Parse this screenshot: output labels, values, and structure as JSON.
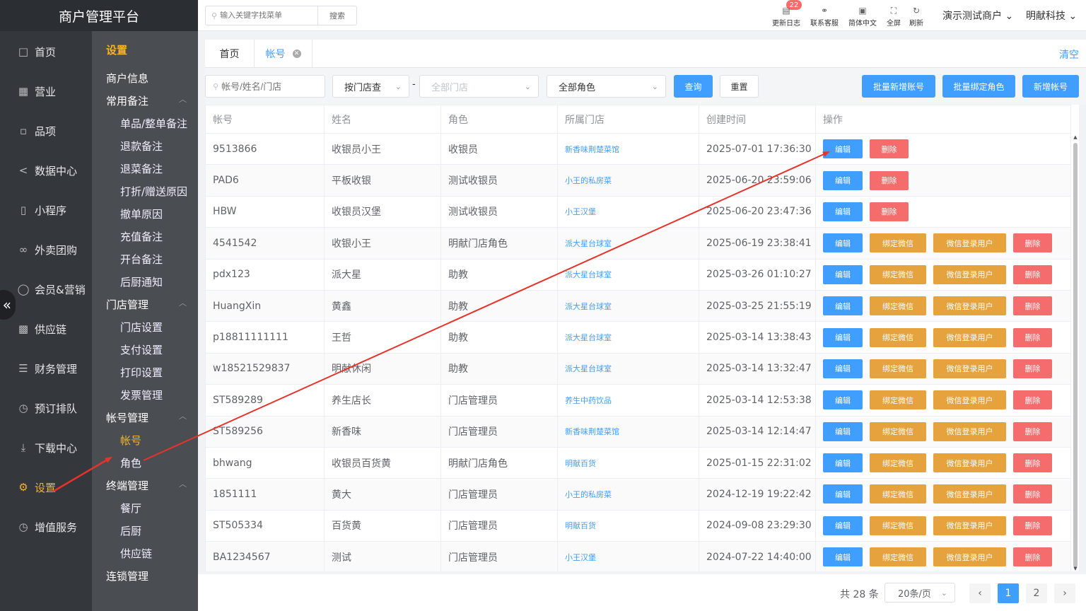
{
  "app": {
    "title": "商户管理平台"
  },
  "nav1": [
    {
      "label": "首页",
      "icon": "home-icon"
    },
    {
      "label": "营业",
      "icon": "calendar-icon"
    },
    {
      "label": "品项",
      "icon": "bag-icon"
    },
    {
      "label": "数据中心",
      "icon": "share-icon"
    },
    {
      "label": "小程序",
      "icon": "phone-icon"
    },
    {
      "label": "外卖团购",
      "icon": "bike-icon"
    },
    {
      "label": "会员&营销",
      "icon": "user-icon"
    },
    {
      "label": "供应链",
      "icon": "truck-icon"
    },
    {
      "label": "财务管理",
      "icon": "database-icon"
    },
    {
      "label": "预订排队",
      "icon": "clock-icon"
    },
    {
      "label": "下载中心",
      "icon": "download-icon"
    },
    {
      "label": "设置",
      "icon": "gear-icon"
    },
    {
      "label": "增值服务",
      "icon": "alarm-icon"
    }
  ],
  "nav2": {
    "section": "设置",
    "items": [
      {
        "type": "g",
        "label": "商户信息"
      },
      {
        "type": "g",
        "label": "常用备注",
        "arrow": "︿"
      },
      {
        "type": "s",
        "label": "单品/整单备注"
      },
      {
        "type": "s",
        "label": "退款备注"
      },
      {
        "type": "s",
        "label": "退菜备注"
      },
      {
        "type": "s",
        "label": "打折/赠送原因"
      },
      {
        "type": "s",
        "label": "撤单原因"
      },
      {
        "type": "s",
        "label": "充值备注"
      },
      {
        "type": "s",
        "label": "开台备注"
      },
      {
        "type": "s",
        "label": "后厨通知"
      },
      {
        "type": "g",
        "label": "门店管理",
        "arrow": "︿"
      },
      {
        "type": "s",
        "label": "门店设置"
      },
      {
        "type": "s",
        "label": "支付设置"
      },
      {
        "type": "s",
        "label": "打印设置"
      },
      {
        "type": "s",
        "label": "发票管理"
      },
      {
        "type": "g",
        "label": "帐号管理",
        "arrow": "︿"
      },
      {
        "type": "s",
        "label": "帐号",
        "active": true
      },
      {
        "type": "s",
        "label": "角色"
      },
      {
        "type": "g",
        "label": "终端管理",
        "arrow": "︿"
      },
      {
        "type": "s",
        "label": "餐厅"
      },
      {
        "type": "s",
        "label": "后厨"
      },
      {
        "type": "s",
        "label": "供应链"
      },
      {
        "type": "g",
        "label": "连锁管理"
      }
    ]
  },
  "topbar": {
    "search_placeholder": "输入关键字找菜单",
    "search_button": "搜索",
    "badge": "22",
    "items": [
      "更新日志",
      "联系客服",
      "简体中文",
      "全屏",
      "刷新"
    ],
    "merchant": "演示测试商户",
    "company": "明献科技"
  },
  "tabs": {
    "home": "首页",
    "current": "帐号",
    "clear": "清空"
  },
  "filter": {
    "account_placeholder": "帐号/姓名/门店",
    "store_mode": "按门店查",
    "dash": "-",
    "store_placeholder": "全部门店",
    "role": "全部角色",
    "query": "查询",
    "reset": "重置",
    "batch_add": "批量新增账号",
    "batch_bind": "批量绑定角色",
    "add": "新增帐号"
  },
  "table": {
    "headers": [
      "帐号",
      "姓名",
      "角色",
      "所属门店",
      "创建时间",
      "操作"
    ],
    "actions": {
      "edit": "编辑",
      "delete": "删除",
      "bind_wx": "绑定微信",
      "wx_login": "微信登录用户"
    },
    "rows": [
      {
        "account": "9513866",
        "name": "收银员小王",
        "role": "收银员",
        "store": "新香味荆楚菜馆",
        "created": "2025-07-01 17:36:30",
        "full": false
      },
      {
        "account": "PAD6",
        "name": "平板收银",
        "role": "测试收银员",
        "store": "小王的私房菜",
        "created": "2025-06-20 23:59:06",
        "full": false
      },
      {
        "account": "HBW",
        "name": "收银员汉堡",
        "role": "测试收银员",
        "store": "小王汉堡",
        "created": "2025-06-20 23:47:36",
        "full": false
      },
      {
        "account": "4541542",
        "name": "收银小王",
        "role": "明献门店角色",
        "store": "派大星台球室",
        "created": "2025-06-19 23:38:41",
        "full": true
      },
      {
        "account": "pdx123",
        "name": "派大星",
        "role": "助教",
        "store": "派大星台球室",
        "created": "2025-03-26 01:10:27",
        "full": true
      },
      {
        "account": "HuangXin",
        "name": "黄鑫",
        "role": "助教",
        "store": "派大星台球室",
        "created": "2025-03-25 21:55:19",
        "full": true
      },
      {
        "account": "p18811111111",
        "name": "王哲",
        "role": "助教",
        "store": "派大星台球室",
        "created": "2025-03-14 13:38:43",
        "full": true
      },
      {
        "account": "w18521529837",
        "name": "明献休闲",
        "role": "助教",
        "store": "派大星台球室",
        "created": "2025-03-14 13:32:47",
        "full": true
      },
      {
        "account": "ST589289",
        "name": "养生店长",
        "role": "门店管理员",
        "store": "养生中药饮品",
        "created": "2025-03-14 12:53:38",
        "full": true
      },
      {
        "account": "ST589256",
        "name": "新香味",
        "role": "门店管理员",
        "store": "新香味荆楚菜馆",
        "created": "2025-03-14 12:14:47",
        "full": true
      },
      {
        "account": "bhwang",
        "name": "收银员百货黄",
        "role": "明献门店角色",
        "store": "明献百货",
        "created": "2025-01-15 22:31:02",
        "full": true
      },
      {
        "account": "1851111",
        "name": "黄大",
        "role": "门店管理员",
        "store": "小王的私房菜",
        "created": "2024-12-19 19:22:42",
        "full": true
      },
      {
        "account": "ST505334",
        "name": "百货黄",
        "role": "门店管理员",
        "store": "明献百货",
        "created": "2024-09-08 23:29:30",
        "full": true
      },
      {
        "account": "BA1234567",
        "name": "测试",
        "role": "门店管理员",
        "store": "小王汉堡",
        "created": "2024-07-22 14:40:00",
        "full": true
      }
    ]
  },
  "pagination": {
    "total": "共 28 条",
    "page_size": "20条/页",
    "pages": [
      "1",
      "2"
    ],
    "current": "1"
  },
  "colors": {
    "primary": "#409eff",
    "danger": "#f56c6c",
    "warning": "#e6a23c",
    "sidebar": "#34373c",
    "accent": "#f5b22d",
    "annotation": "#e8322a"
  }
}
